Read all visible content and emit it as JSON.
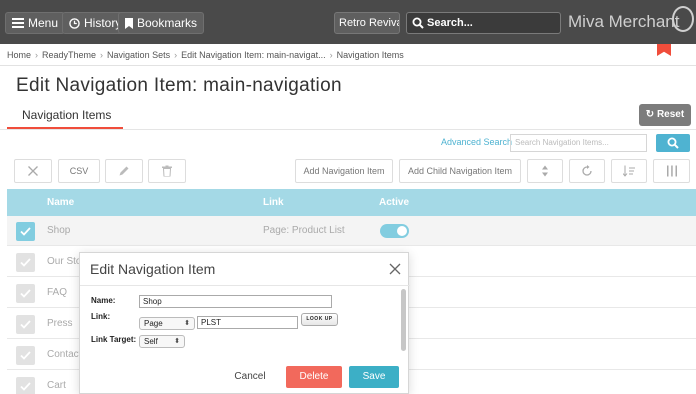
{
  "topbar": {
    "menu_label": "Menu",
    "history_label": "History",
    "bookmarks_label": "Bookmarks",
    "store_select_value": "Retro Revival",
    "search_placeholder": "Search...",
    "brand": "Miva Merchant"
  },
  "breadcrumb": [
    "Home",
    "ReadyTheme",
    "Navigation Sets",
    "Edit Navigation Item: main-navigat...",
    "Navigation Items"
  ],
  "page_title": "Edit Navigation Item: main-navigation",
  "tab_label": "Navigation Items",
  "reset_label": "Reset",
  "advanced_search_label": "Advanced Search",
  "nav_search_placeholder": "Search Navigation Items...",
  "toolbar": {
    "csv_label": "CSV",
    "add_item_label": "Add Navigation Item",
    "add_child_label": "Add Child Navigation Item"
  },
  "table": {
    "headers": [
      "Name",
      "Link",
      "Active"
    ],
    "rows": [
      {
        "name": "Shop",
        "link": "Page: Product List",
        "active": true,
        "checked": true
      },
      {
        "name": "Our Sto",
        "link": "",
        "active": false,
        "checked": false
      },
      {
        "name": "FAQ",
        "link": "",
        "active": false,
        "checked": false
      },
      {
        "name": "Press",
        "link": "",
        "active": false,
        "checked": false
      },
      {
        "name": "Contact",
        "link": "",
        "active": false,
        "checked": false
      },
      {
        "name": "Cart",
        "link": "",
        "active": false,
        "checked": false
      }
    ]
  },
  "modal": {
    "title": "Edit Navigation Item",
    "name_label": "Name:",
    "name_value": "Shop",
    "link_label": "Link:",
    "link_type": "Page",
    "link_value": "PLST",
    "lookup_label": "LOOK UP",
    "target_label": "Link Target:",
    "target_value": "Self",
    "cancel_label": "Cancel",
    "delete_label": "Delete",
    "save_label": "Save"
  },
  "colors": {
    "topbar": "#4a4a4a",
    "accent_red": "#f04d3b",
    "accent_blue": "#4fb3d1",
    "table_header": "#a4d9e6",
    "save": "#3cafc6",
    "delete": "#f2695c"
  },
  "icons": [
    "hamburger-icon",
    "clock-icon",
    "bookmark-icon",
    "search-icon",
    "refresh-icon",
    "close-icon",
    "pencil-icon",
    "trash-icon",
    "sort-arrows-icon",
    "refresh-icon",
    "sort-list-icon",
    "columns-icon",
    "checkmark-icon"
  ]
}
